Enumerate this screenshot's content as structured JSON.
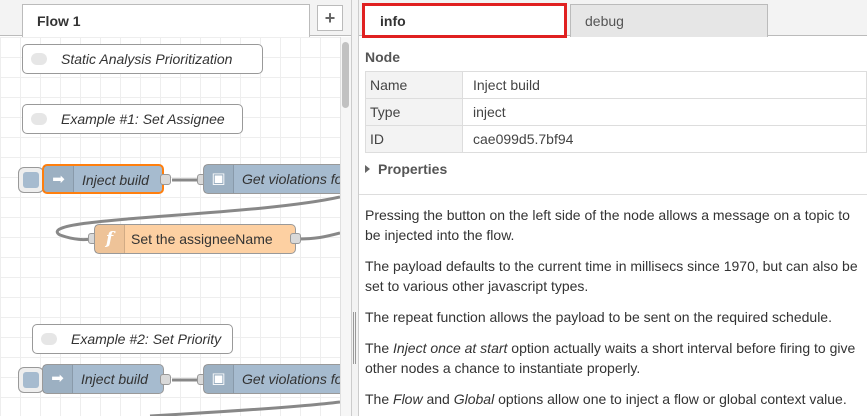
{
  "workspace": {
    "tab_label": "Flow 1",
    "add_tab_label": "+"
  },
  "nodes": {
    "comment1": "Static Analysis Prioritization",
    "comment2": "Example #1: Set Assignee",
    "inject1": "Inject build",
    "getviol1": "Get violations fo",
    "func1": "Set the assigneeName",
    "comment3": "Example #2: Set Priority",
    "inject2": "Inject build",
    "getviol2": "Get violations fo"
  },
  "sidebar": {
    "tabs": {
      "info": "info",
      "debug": "debug"
    },
    "section_title": "Node",
    "rows": [
      {
        "key": "Name",
        "value": "Inject build"
      },
      {
        "key": "Type",
        "value": "inject"
      },
      {
        "key": "ID",
        "value": "cae099d5.7bf94"
      }
    ],
    "properties_label": "Properties",
    "help": {
      "p1": "Pressing the button on the left side of the node allows a message on a topic to be injected into the flow.",
      "p2": "The payload defaults to the current time in millisecs since 1970, but can also be set to various other javascript types.",
      "p3": "The repeat function allows the payload to be sent on the required schedule.",
      "p4": {
        "pre": "The ",
        "em": "Inject once at start",
        "post": " option actually waits a short interval before firing to give other nodes a chance to instantiate properly."
      },
      "p5": {
        "pre": "The ",
        "em1": "Flow",
        "mid": " and ",
        "em2": "Global",
        "post": " options allow one to inject a flow or global context value."
      }
    }
  },
  "colors": {
    "inject_node": "#a6bbcf",
    "function_node": "#fdd0a2",
    "selection": "#ff7f0e",
    "highlight": "#e02020"
  },
  "icons": {
    "comment": "speech-bubble-icon",
    "inject": "arrow-right-icon",
    "function": "function-f-icon",
    "getviol": "api-box-icon"
  }
}
